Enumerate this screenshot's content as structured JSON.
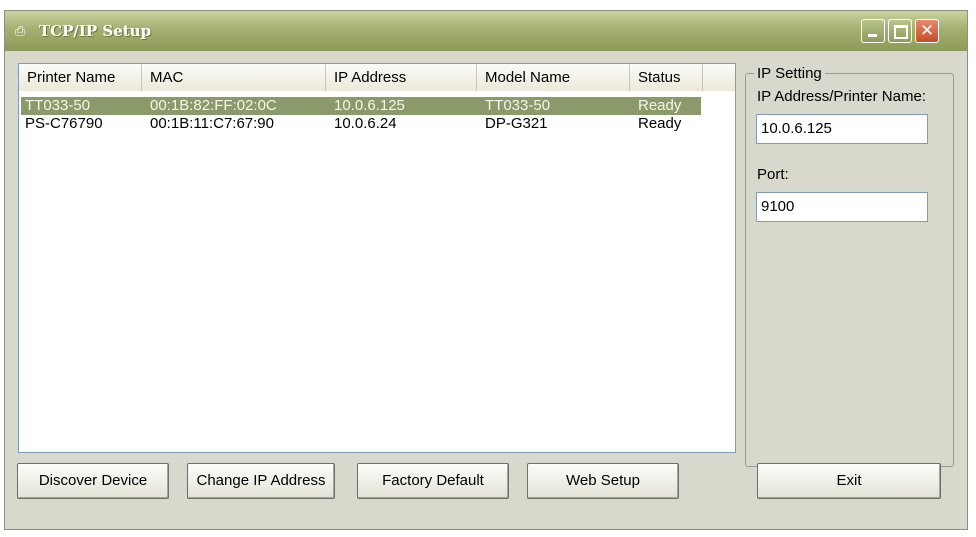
{
  "window": {
    "title": "TCP/IP Setup",
    "close_glyph": "✕"
  },
  "printer_list": {
    "columns": [
      "Printer Name",
      "MAC",
      "IP Address",
      "Model Name",
      "Status"
    ],
    "rows": [
      {
        "printer_name": "TT033-50",
        "mac": "00:1B:82:FF:02:0C",
        "ip_address": "10.0.6.125",
        "model_name": "TT033-50",
        "status": "Ready",
        "selected": true
      },
      {
        "printer_name": "PS-C76790",
        "mac": "00:1B:11:C7:67:90",
        "ip_address": "10.0.6.24",
        "model_name": "DP-G321",
        "status": "Ready",
        "selected": false
      }
    ]
  },
  "ip_setting": {
    "group_label": "IP Setting",
    "address_label": "IP Address/Printer Name:",
    "address_value": "10.0.6.125",
    "port_label": "Port:",
    "port_value": "9100"
  },
  "buttons": {
    "discover": "Discover Device",
    "change_ip": "Change IP Address",
    "factory_default": "Factory Default",
    "web_setup": "Web Setup",
    "exit": "Exit"
  },
  "colors": {
    "titlebar": "#9aa765",
    "selection": "#8c9a6b",
    "close_button": "#d0562f"
  },
  "icons": {
    "app": "printer-icon"
  }
}
